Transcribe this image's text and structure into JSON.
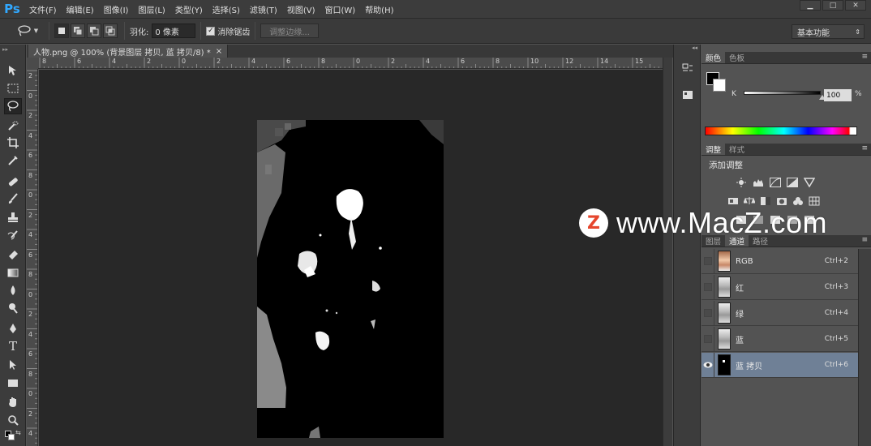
{
  "menubar": {
    "logo": "Ps",
    "items": [
      "文件(F)",
      "编辑(E)",
      "图像(I)",
      "图层(L)",
      "类型(Y)",
      "选择(S)",
      "滤镜(T)",
      "视图(V)",
      "窗口(W)",
      "帮助(H)"
    ],
    "win_min": "▁",
    "win_max": "□",
    "win_close": "✕"
  },
  "options": {
    "feather_label": "羽化:",
    "feather_value": "0 像素",
    "antialias_label": "消除锯齿",
    "antialias_checked": true,
    "refine_edge": "调整边缘...",
    "workspace": "基本功能"
  },
  "document": {
    "tab_title": "人物.png @ 100% (背景图层 拷贝, 蓝 拷贝/8) *",
    "close": "×",
    "ruler_top": [
      "8",
      "6",
      "4",
      "2",
      "0",
      "2",
      "4",
      "6",
      "8",
      "0",
      "2",
      "4",
      "6",
      "8",
      "10",
      "12",
      "14",
      "15"
    ],
    "ruler_left": [
      "2",
      "0",
      "2",
      "4",
      "6",
      "8",
      "0",
      "2",
      "4",
      "6",
      "8",
      "0",
      "2",
      "4",
      "6",
      "8",
      "0",
      "2",
      "4"
    ]
  },
  "color_panel": {
    "tabs": [
      "颜色",
      "色板"
    ],
    "k_label": "K",
    "k_value": "100",
    "k_unit": "%",
    "accent_fg": "#000000",
    "accent_bg": "#ffffff"
  },
  "adjust_panel": {
    "tabs": [
      "调整",
      "样式"
    ],
    "title": "添加调整",
    "row1_icons": [
      "brightness-icon",
      "levels-icon",
      "curves-icon",
      "exposure-icon",
      "vibrance-icon"
    ],
    "row2_icons": [
      "hue-sat-icon",
      "color-balance-icon",
      "bw-icon",
      "photo-filter-icon",
      "channel-mixer-icon",
      "color-lookup-icon"
    ],
    "row3_icons": [
      "invert-icon",
      "posterize-icon",
      "threshold-icon",
      "gradient-map-icon",
      "selective-color-icon"
    ]
  },
  "channels_panel": {
    "tabs": [
      "图层",
      "通道",
      "路径"
    ],
    "rows": [
      {
        "name": "RGB",
        "shortcut": "Ctrl+2"
      },
      {
        "name": "红",
        "shortcut": "Ctrl+3"
      },
      {
        "name": "绿",
        "shortcut": "Ctrl+4"
      },
      {
        "name": "蓝",
        "shortcut": "Ctrl+5"
      },
      {
        "name": "蓝 拷贝",
        "shortcut": "Ctrl+6"
      }
    ],
    "selected_color": "#6f8096"
  },
  "watermark": {
    "logo_letter": "Z",
    "text": "www.MacZ.com"
  }
}
